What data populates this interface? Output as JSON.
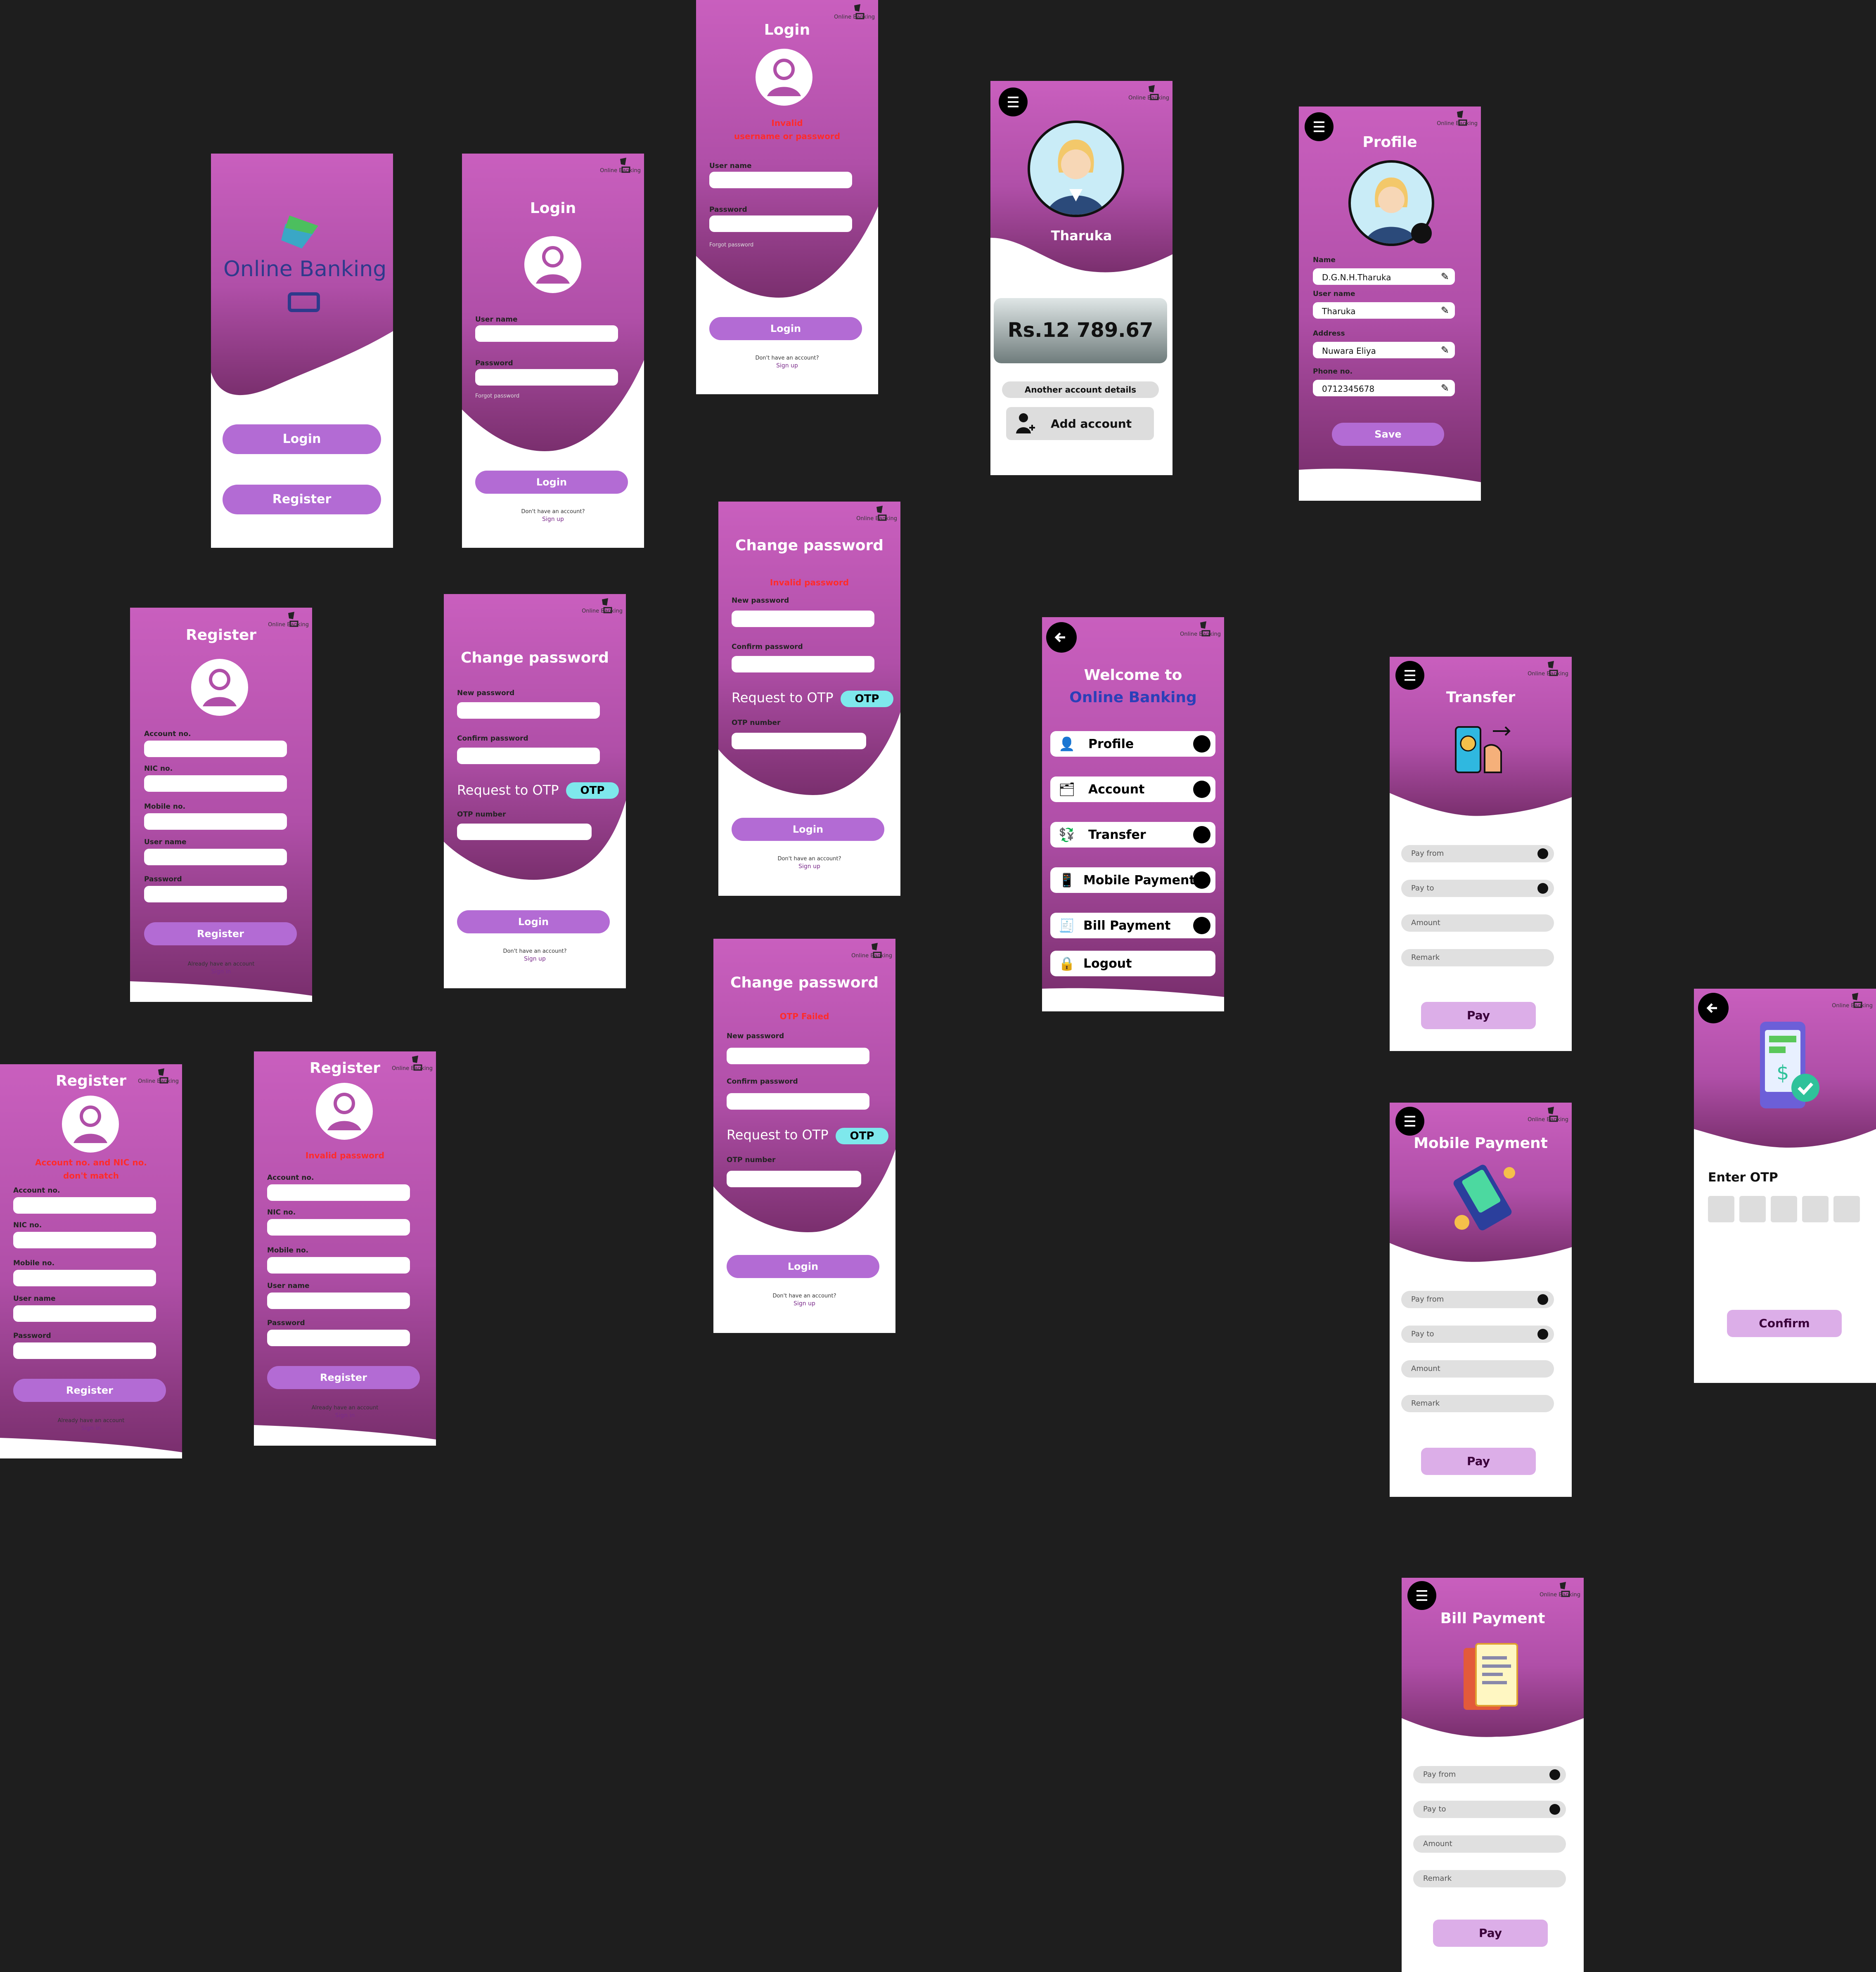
{
  "brand": {
    "logo_text_1": "Online",
    "logo_text_2": "Banking",
    "mini": "Online Banking"
  },
  "colors": {
    "purple_top": "#c95fbe",
    "purple_mid": "#b04fa8",
    "purple_dark": "#7a2f6e",
    "error": "#ff2b2b",
    "otp": "#7ee8ec"
  },
  "welcome": {
    "login": "Login",
    "register": "Register"
  },
  "login": {
    "title": "Login",
    "username_label": "User name",
    "password_label": "Password",
    "forgot": "Forgot password",
    "button": "Login",
    "no_account": "Don't have an account?",
    "signup": "Sign up",
    "error_line1": "Invalid",
    "error_line2": "username or password"
  },
  "change_password": {
    "title": "Change password",
    "new_label": "New password",
    "confirm_label": "Confirm password",
    "request_otp": "Request to OTP",
    "otp_tag": "OTP",
    "otp_label": "OTP number",
    "button": "Login",
    "no_account": "Don't have an account?",
    "signup": "Sign up",
    "error_invalid": "Invalid password",
    "error_otp": "OTP Failed"
  },
  "register": {
    "title": "Register",
    "account_label": "Account no.",
    "nic_label": "NIC no.",
    "mobile_label": "Mobile no.",
    "username_label": "User name",
    "password_label": "Password",
    "button": "Register",
    "already": "Already have an account",
    "signin": "Sign in",
    "error_match_1": "Account no. and NIC no.",
    "error_match_2": "don't match",
    "error_invalid_pw": "Invalid password"
  },
  "dashboard": {
    "user_name": "Tharuka",
    "balance": "Rs.12 789.67",
    "another_account": "Another account details",
    "add_account": "Add account"
  },
  "profile": {
    "title": "Profile",
    "fields": [
      {
        "label": "Name",
        "value": "D.G.N.H.Tharuka"
      },
      {
        "label": "User name",
        "value": "Tharuka"
      },
      {
        "label": "Address",
        "value": "Nuwara Eliya"
      },
      {
        "label": "Phone no.",
        "value": "0712345678"
      }
    ],
    "save": "Save"
  },
  "menu": {
    "title_1": "Welcome to",
    "title_2": "Online Banking",
    "items": [
      "Profile",
      "Account",
      "Transfer",
      "Mobile Payment",
      "Bill Payment",
      "Logout"
    ]
  },
  "transfer": {
    "title": "Transfer",
    "pay_from": "Pay from",
    "pay_to": "Pay to",
    "amount": "Amount",
    "remark": "Remark",
    "pay": "Pay"
  },
  "mobile_payment": {
    "title": "Mobile Payment",
    "pay_from": "Pay from",
    "pay_to": "Pay to",
    "amount": "Amount",
    "remark": "Remark",
    "pay": "Pay"
  },
  "bill_payment": {
    "title": "Bill Payment",
    "pay_from": "Pay from",
    "pay_to": "Pay to",
    "amount": "Amount",
    "remark": "Remark",
    "pay": "Pay"
  },
  "otp_screen": {
    "label": "Enter OTP",
    "confirm": "Confirm"
  }
}
